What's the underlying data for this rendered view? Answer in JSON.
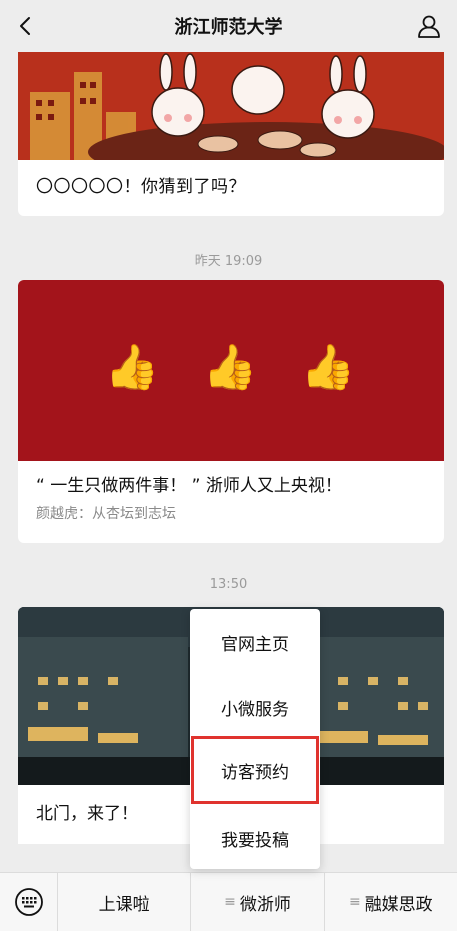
{
  "header": {
    "title": "浙江师范大学",
    "back_icon": "chevron-left-icon",
    "user_icon": "person-icon"
  },
  "feed": [
    {
      "caption": "〇〇〇〇〇！你猜到了吗？"
    },
    {
      "timestamp": "昨天 19:09",
      "caption": "“ 一生只做两件事！ ” 浙师人又上央视！",
      "subtitle": "颜越虎：从杏坛到志坛",
      "emoji": "👍"
    },
    {
      "timestamp": "13:50",
      "caption": "北门，来了！"
    }
  ],
  "popup_menu": {
    "items": [
      "官网主页",
      "小微服务",
      "访客预约",
      "我要投稿"
    ],
    "highlighted": "访客预约",
    "highlight_color": "#e0332e"
  },
  "bottom_menu": {
    "keyboard_icon": "keyboard-icon",
    "tabs": [
      {
        "label": "上课啦",
        "has_submenu": false
      },
      {
        "label": "微浙师",
        "has_submenu": true
      },
      {
        "label": "融媒思政",
        "has_submenu": true
      }
    ],
    "submenu_glyph": "≡"
  }
}
